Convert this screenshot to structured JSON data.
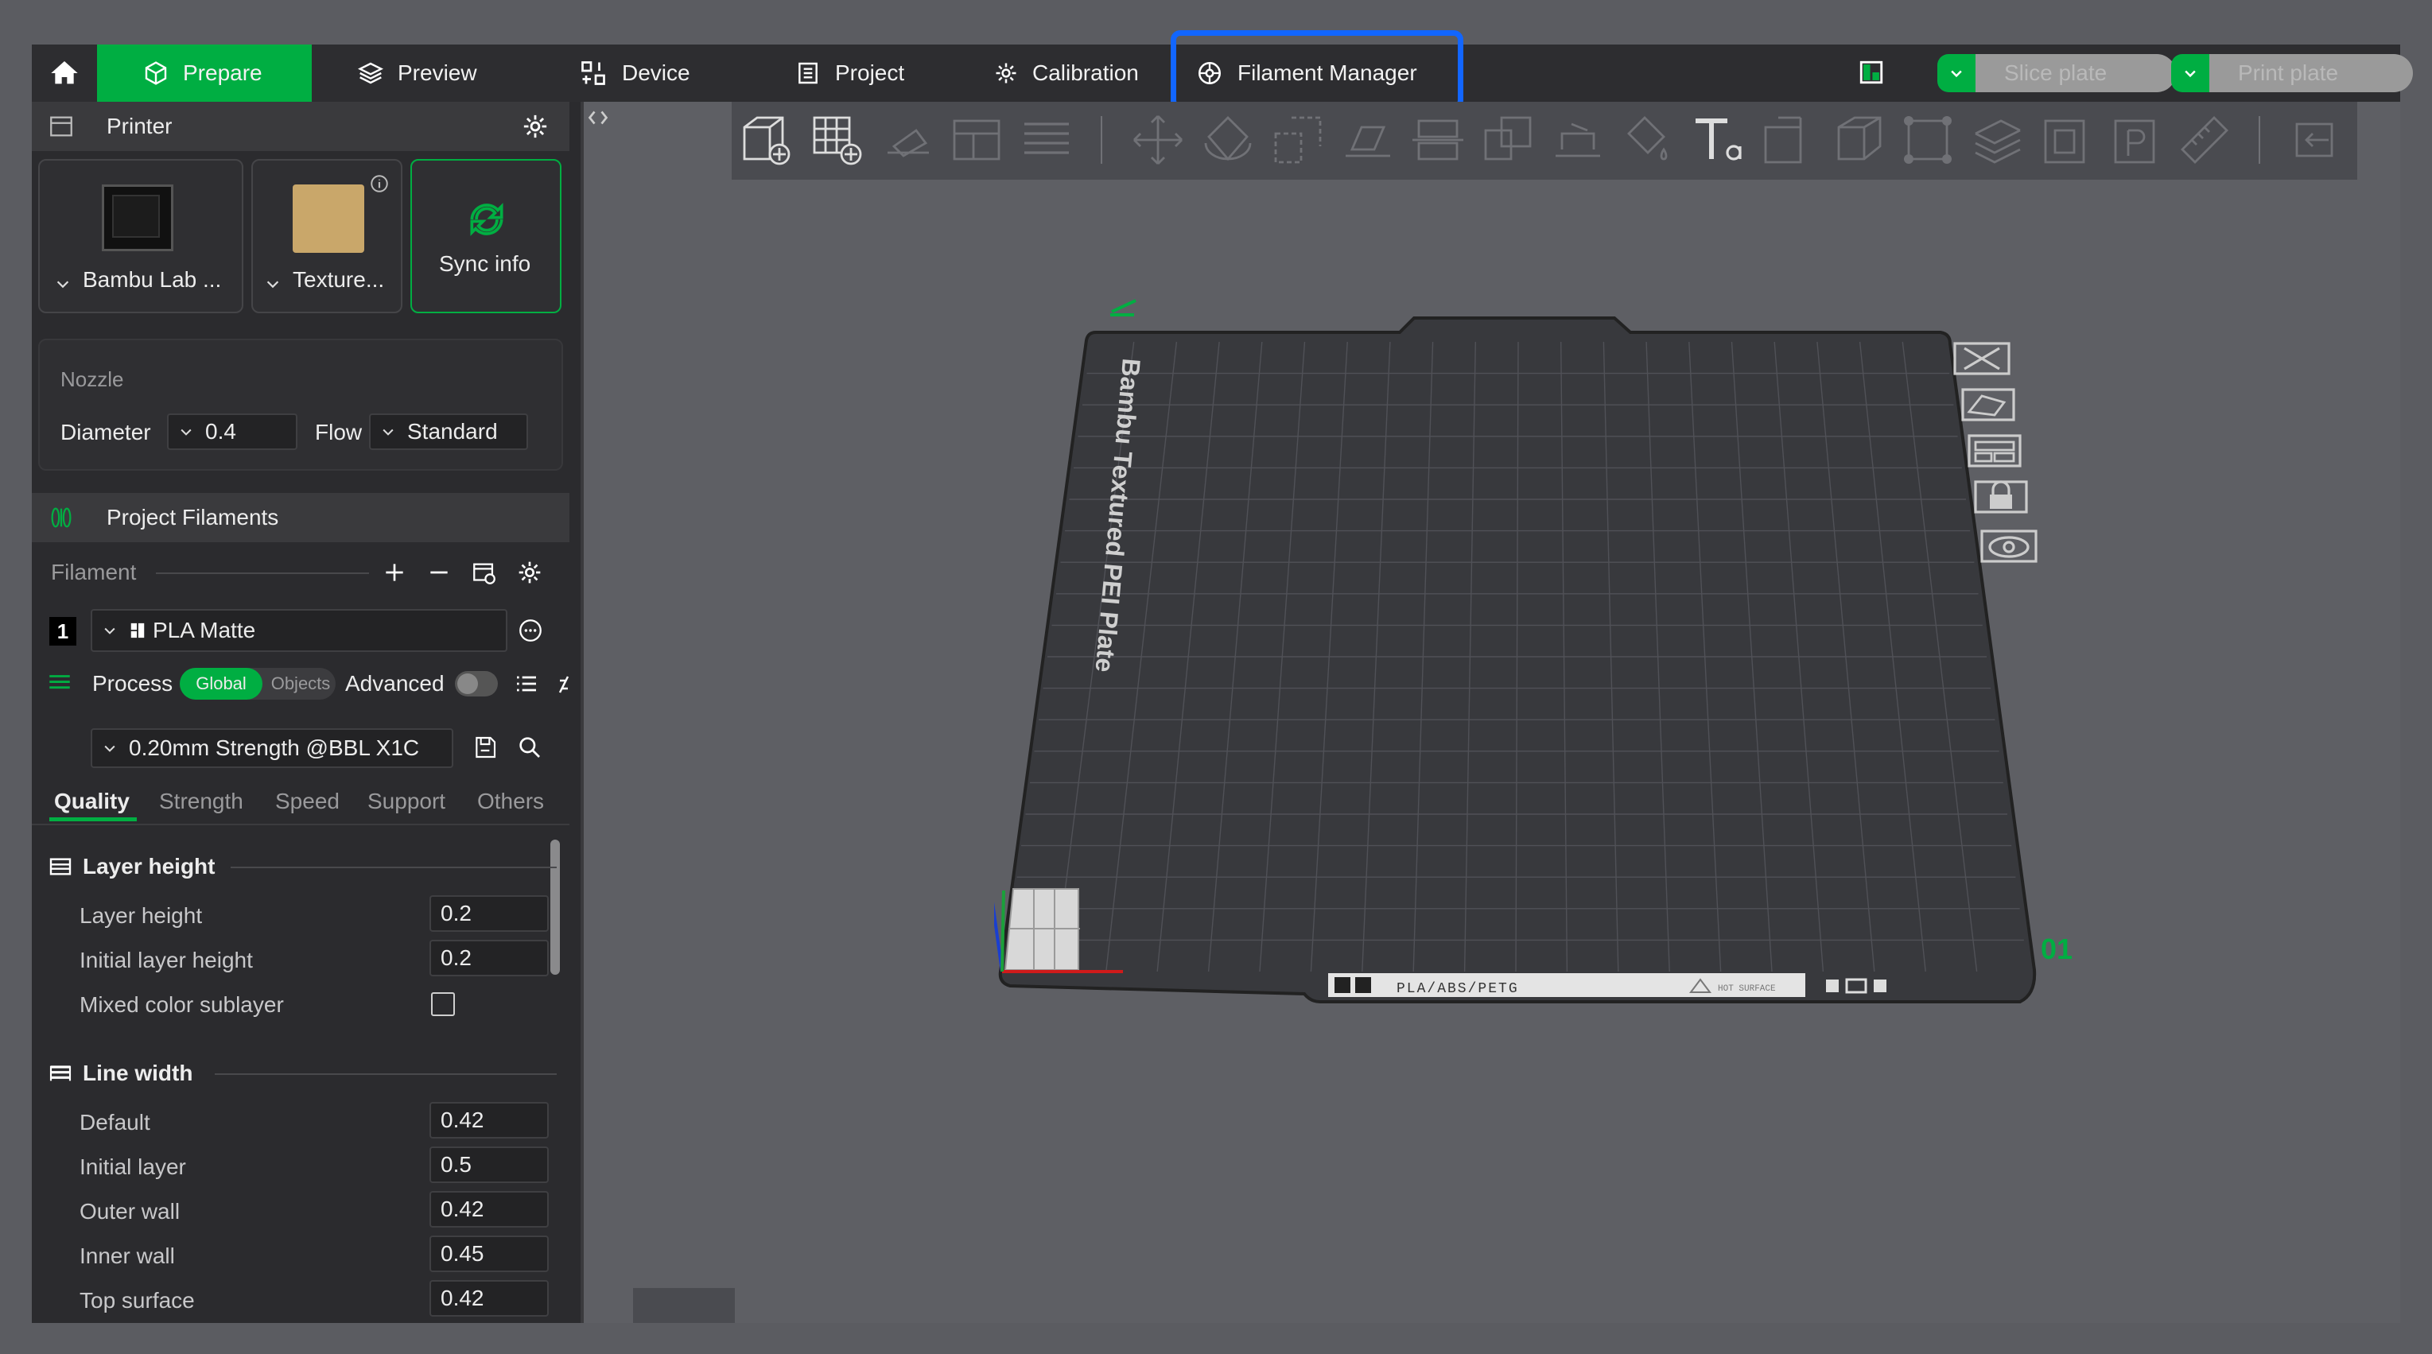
{
  "tabs": [
    {
      "label": "Prepare",
      "icon": "cube-icon",
      "active": true
    },
    {
      "label": "Preview",
      "icon": "layers-icon"
    },
    {
      "label": "Device",
      "icon": "device-icon"
    },
    {
      "label": "Project",
      "icon": "project-icon"
    },
    {
      "label": "Calibration",
      "icon": "gear-icon"
    },
    {
      "label": "Filament Manager",
      "icon": "filament-manager-icon",
      "highlighted": true
    }
  ],
  "actions": {
    "slice_label": "Slice plate",
    "print_label": "Print plate"
  },
  "printer": {
    "section_title": "Printer",
    "printer_name": "Bambu Lab ...",
    "plate_type": "Texture...",
    "sync_label": "Sync info"
  },
  "nozzle": {
    "title": "Nozzle",
    "diameter_label": "Diameter",
    "diameter_value": "0.4",
    "flow_label": "Flow",
    "flow_value": "Standard"
  },
  "filaments": {
    "section_title": "Project Filaments",
    "filament_label": "Filament",
    "items": [
      {
        "index": "1",
        "name": "PLA Matte",
        "color": "#000000"
      }
    ]
  },
  "process": {
    "title": "Process",
    "global_label": "Global",
    "objects_label": "Objects",
    "advanced_label": "Advanced",
    "preset": "0.20mm Strength @BBL X1C",
    "tabs": [
      "Quality",
      "Strength",
      "Speed",
      "Support",
      "Others"
    ],
    "active_tab": "Quality"
  },
  "settings": {
    "layer_height_group": "Layer height",
    "layer_height_label": "Layer height",
    "layer_height_value": "0.2",
    "initial_layer_height_label": "Initial layer height",
    "initial_layer_height_value": "0.2",
    "mixed_color_label": "Mixed color sublayer",
    "line_width_group": "Line width",
    "default_label": "Default",
    "default_value": "0.42",
    "initial_layer_label": "Initial layer",
    "initial_layer_value": "0.5",
    "outer_wall_label": "Outer wall",
    "outer_wall_value": "0.42",
    "inner_wall_label": "Inner wall",
    "inner_wall_value": "0.45",
    "top_surface_label": "Top surface",
    "top_surface_value": "0.42"
  },
  "plate": {
    "name": "Bambu Textured PEI Plate",
    "number": "01",
    "label_strip": "PLA/ABS/PETG",
    "hot_surface": "HOT SURFACE"
  },
  "colors": {
    "accent": "#00ae42",
    "highlight": "#1266ff",
    "panel": "#2b2b2e",
    "viewport": "#5e5f64"
  }
}
